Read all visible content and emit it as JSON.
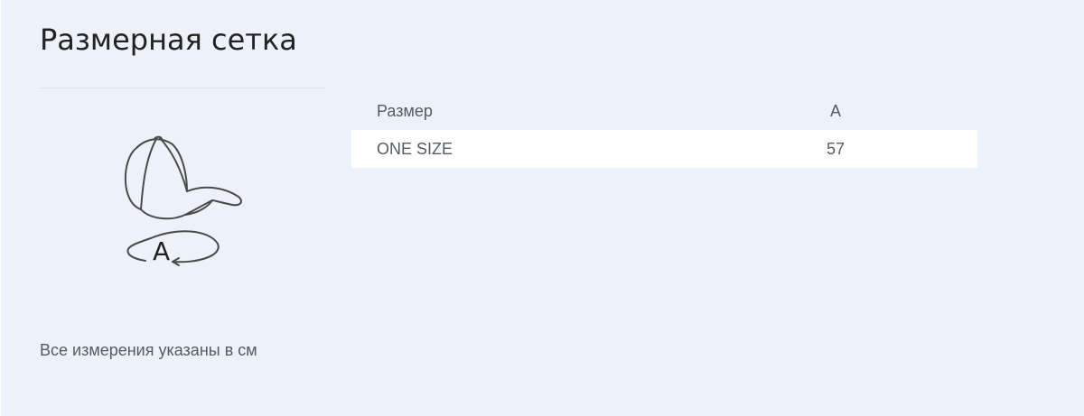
{
  "title": "Размерная сетка",
  "illustration": {
    "icon": "baseball-cap-icon",
    "measure_label": "A"
  },
  "note": "Все измерения указаны в см",
  "table": {
    "headers": [
      "Размер",
      "A"
    ],
    "rows": [
      [
        "ONE SIZE",
        "57"
      ]
    ]
  },
  "colors": {
    "background": "#edf1fa",
    "row_background": "#ffffff",
    "title_text": "#222222",
    "body_text": "#555b63"
  }
}
